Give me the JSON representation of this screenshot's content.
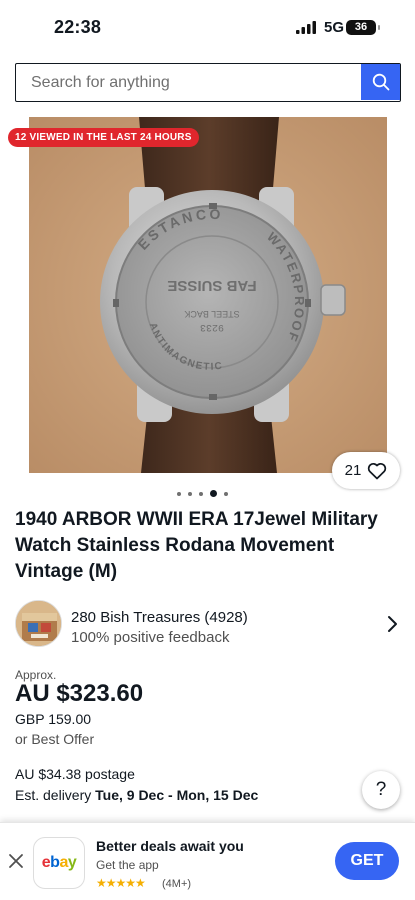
{
  "status_bar": {
    "time": "22:38",
    "network": "5G",
    "battery": "36"
  },
  "search": {
    "placeholder": "Search for anything"
  },
  "listing": {
    "badge": "12 VIEWED IN THE LAST 24 HOURS",
    "watchers": "21",
    "image_count": 5,
    "active_image": 4,
    "title": "1940 ARBOR WWII ERA 17Jewel Military Watch Stainless Rodana Movement Vintage (M)"
  },
  "seller": {
    "name": "280 Bish Treasures (4928)",
    "feedback": "100% positive feedback"
  },
  "price": {
    "approx_label": "Approx.",
    "main": "AU $323.60",
    "original": "GBP 159.00",
    "best_offer": "or Best Offer"
  },
  "shipping": {
    "postage": "AU $34.38 postage",
    "delivery_label": "Est. delivery ",
    "delivery_dates": "Tue, 9 Dec - Mon, 15 Dec"
  },
  "help": {
    "label": "?"
  },
  "app_banner": {
    "app_icon_text": "ebay",
    "title": "Better deals await you",
    "subtitle": "Get the app",
    "stars": "★★★★★",
    "rating_count": "(4M+)",
    "get_label": "GET"
  },
  "watch_engraving": {
    "ring_top": "ESTANCO",
    "ring_right": "WATERPROOF",
    "center": "FAB SUISSE",
    "ring_lower": "ANTIMAGNETIC",
    "serial": "9233",
    "small": "STEEL BACK"
  },
  "colors": {
    "accent": "#3665f3",
    "badge": "#e0262d",
    "text": "#111820",
    "stars": "#f5af02"
  },
  "icons": [
    "search-icon",
    "heart-icon",
    "chevron-right-icon",
    "close-icon",
    "signal-icon",
    "battery-icon"
  ]
}
